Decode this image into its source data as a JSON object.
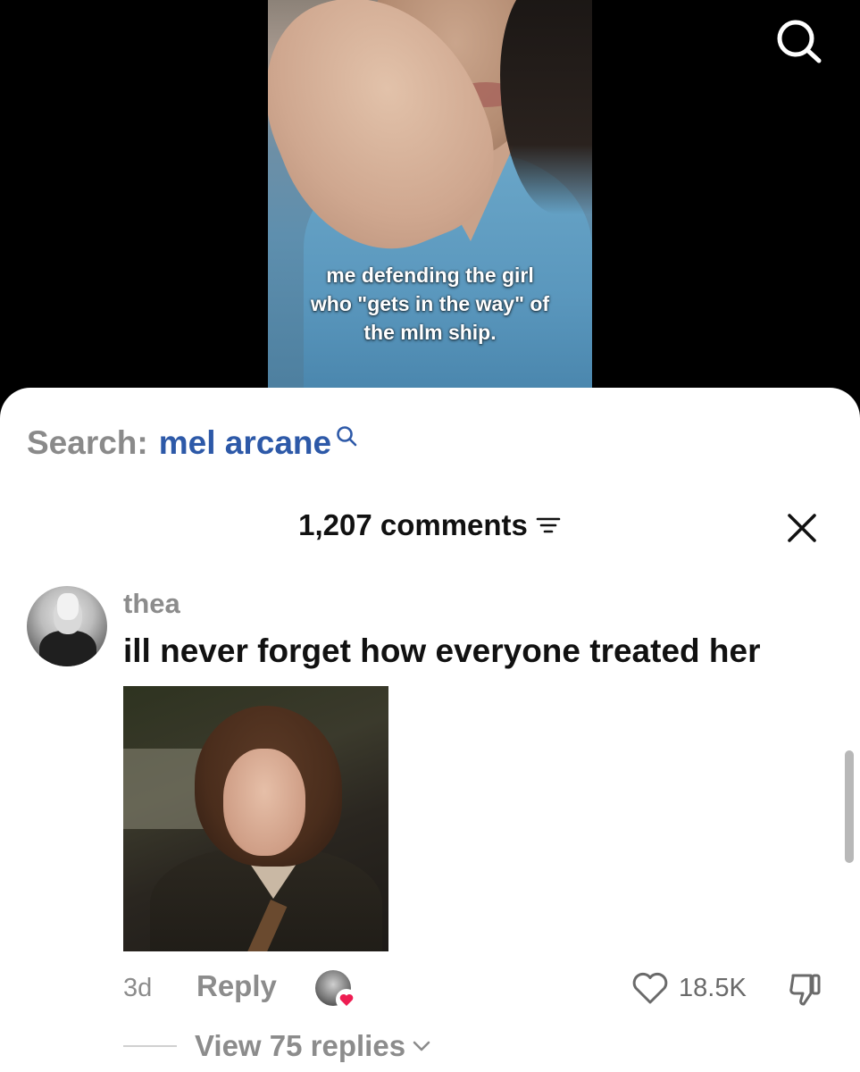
{
  "video": {
    "caption_lines": [
      "me defending the girl",
      "who \"gets in the way\" of",
      "the mlm ship."
    ]
  },
  "search_suggestion": {
    "prefix": "Search:",
    "query": "mel arcane"
  },
  "comments_panel": {
    "count_label": "1,207 comments"
  },
  "comment": {
    "username": "thea",
    "text": "ill never forget how everyone treated her",
    "time": "3d",
    "reply_label": "Reply",
    "like_count": "18.5K",
    "view_replies_label": "View 75 replies"
  },
  "colors": {
    "search_query": "#2d59a8",
    "muted_text": "#8c8c8c",
    "heart_accent": "#ee1d52"
  },
  "icons": {
    "top_search": "search-icon",
    "sort": "sort-filter-icon",
    "close": "close-icon",
    "like": "heart-outline-icon",
    "dislike": "thumbs-down-icon",
    "chevron": "chevron-down-icon"
  }
}
